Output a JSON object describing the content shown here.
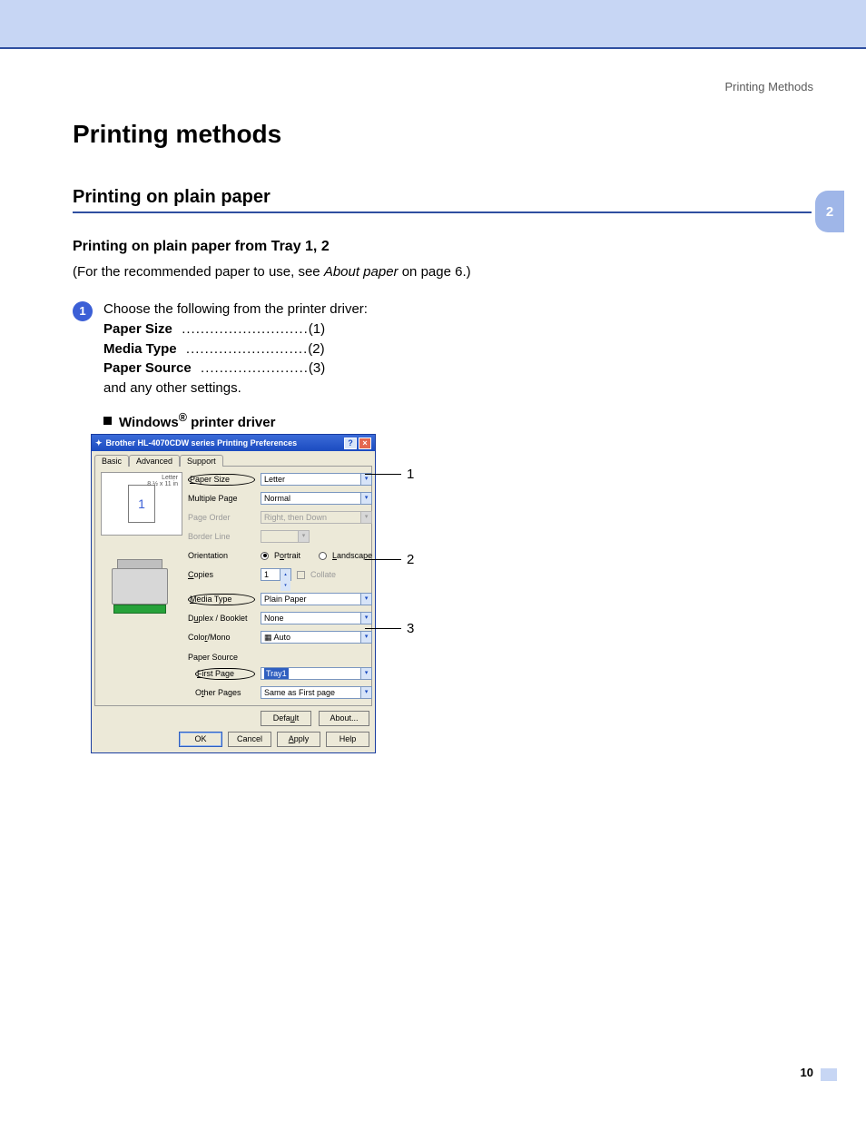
{
  "header": {
    "section": "Printing Methods"
  },
  "sideTab": "2",
  "h1": "Printing methods",
  "h2": "Printing on plain paper",
  "h3": "Printing on plain paper from Tray 1, 2",
  "paragraph": {
    "pre": "(For the recommended paper to use, see ",
    "ital": "About paper",
    "post": " on page 6.)"
  },
  "step": {
    "badge": "1",
    "lead": "Choose the following from the printer driver:",
    "lines": [
      {
        "label": "Paper Size",
        "num": "(1)"
      },
      {
        "label": "Media Type",
        "num": "(2)"
      },
      {
        "label": "Paper Source",
        "num": "(3)"
      }
    ],
    "tail": "and any other settings."
  },
  "driverHead": {
    "pre": "Windows",
    "sup": "®",
    "post": " printer driver"
  },
  "dialog": {
    "title": "Brother HL-4070CDW series Printing Preferences",
    "help": "?",
    "close": "×",
    "tabs": {
      "basic": "Basic",
      "advanced": "Advanced",
      "support": "Support"
    },
    "preview": {
      "line1": "Letter",
      "line2": "8 ½ x 11 in",
      "pagenum": "1"
    },
    "labels": {
      "paperSize": "Paper Size",
      "multiplePage": "Multiple Page",
      "pageOrder": "Page Order",
      "borderLine": "Border Line",
      "orientation": "Orientation",
      "copies": "Copies",
      "mediaType": "Media Type",
      "duplex": "Duplex / Booklet",
      "colorMono": "Color/Mono",
      "paperSource": "Paper Source",
      "firstPage": "First Page",
      "otherPages": "Other Pages"
    },
    "values": {
      "paperSize": "Letter",
      "multiplePage": "Normal",
      "pageOrder": "Right, then Down",
      "portrait": "Portrait",
      "landscape": "Landscape",
      "copies": "1",
      "collate": "Collate",
      "mediaType": "Plain Paper",
      "duplex": "None",
      "colorMono": "Auto",
      "firstPage": "Tray1",
      "otherPages": "Same as First page"
    },
    "subButtons": {
      "default": "Default",
      "about": "About..."
    },
    "buttons": {
      "ok": "OK",
      "cancel": "Cancel",
      "apply": "Apply",
      "help": "Help"
    }
  },
  "callouts": {
    "c1": "1",
    "c2": "2",
    "c3": "3"
  },
  "pageNumber": "10"
}
